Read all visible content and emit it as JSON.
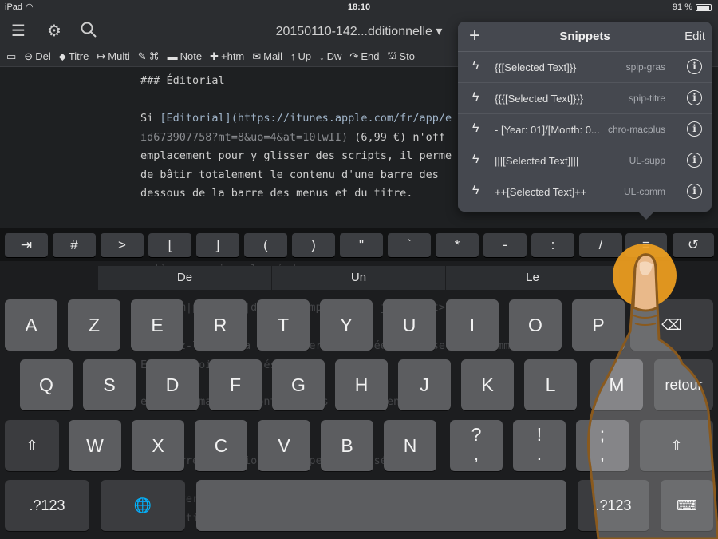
{
  "status": {
    "device": "iPad",
    "time": "18:10",
    "battery": "91 %",
    "battery_level": 0.91
  },
  "titlebar": {
    "doc_title": "20150110-142...dditionnelle ▾",
    "icons": [
      "menu-icon",
      "gear-icon",
      "search-icon"
    ]
  },
  "toolbar": {
    "items": [
      {
        "icon": "book-icon",
        "glyph": "▭",
        "label": ""
      },
      {
        "icon": "delete-circle-icon",
        "glyph": "⊖",
        "label": "Del"
      },
      {
        "icon": "tag-icon",
        "glyph": "⬥",
        "label": "Titre"
      },
      {
        "icon": "export-icon",
        "glyph": "↦",
        "label": "Multi"
      },
      {
        "icon": "edit-icon",
        "glyph": "✎",
        "label": "⌘"
      },
      {
        "icon": "comment-icon",
        "glyph": "▬",
        "label": "Note"
      },
      {
        "icon": "pin-icon",
        "glyph": "✚",
        "label": "+htm"
      },
      {
        "icon": "mail-icon",
        "glyph": "✉",
        "label": "Mail"
      },
      {
        "icon": "arrow-up-icon",
        "glyph": "↑",
        "label": "Up"
      },
      {
        "icon": "arrow-down-icon",
        "glyph": "↓",
        "label": "Dw"
      },
      {
        "icon": "end-icon",
        "glyph": "↷",
        "label": "End"
      },
      {
        "icon": "stamp-icon",
        "glyph": "⛫",
        "label": "Sto"
      }
    ]
  },
  "editor": {
    "heading": "### Éditorial",
    "line1_a": "Si ",
    "line1_b": "[Editorial](https://itunes.apple.com/fr/app/e",
    "line2_a": "id673907758?mt=8&uo=4&at=10lwII)",
    "line2_b": " (6,99 €) n'off",
    "line3": "emplacement pour y glisser des scripts, il perme",
    "line4": "de bâtir totalement le contenu d'une barre des",
    "line5": "dessous de la barre des menus et du titre."
  },
  "ghost_text": [
    "qu'à un appui prolongé deva",
    "<medium|pull.jpg|dafts <cymp...|ppl> jpg|right>",
    "Ajoutez-les de la barre, personnalisée, utiliser des commandes",
    "En tout point ajoutés",
    "et votre machine sont écrites directement",
    "Les barres additionnelles personnalisées",
    "À l'inverse, c'est vous qui êtes « maître du jeu » et de la",
    "disposition des éléments."
  ],
  "snippets": {
    "title": "Snippets",
    "add_label": "+",
    "edit_label": "Edit",
    "items": [
      {
        "text": "{{[Selected Text]}}",
        "tag": "spip-gras"
      },
      {
        "text": "{{{[Selected Text]}}}",
        "tag": "spip-titre"
      },
      {
        "text": "- [Year: 01]/[Month: 0...",
        "tag": "chro-macplus"
      },
      {
        "text": "|||[Selected Text]|||",
        "tag": "UL-supp"
      },
      {
        "text": "++[Selected Text]++",
        "tag": "UL-comm"
      }
    ]
  },
  "extra_keys": [
    "⇥",
    "#",
    ">",
    "[",
    "]",
    "(",
    ")",
    "\"",
    "`",
    "*",
    "-",
    ":",
    "/",
    "≡",
    "↺"
  ],
  "suggestions": [
    "De",
    "Un",
    "Le"
  ],
  "keys": {
    "row1": [
      "A",
      "Z",
      "E",
      "R",
      "T",
      "Y",
      "U",
      "I",
      "O",
      "P"
    ],
    "row2": [
      "Q",
      "S",
      "D",
      "F",
      "G",
      "H",
      "J",
      "K",
      "L",
      "M"
    ],
    "row3": [
      "W",
      "X",
      "C",
      "V",
      "B",
      "N"
    ],
    "punct1": "?\n,",
    "punct2": "!\n.",
    "punct3": ";\n,",
    "return_label": "retour",
    "numbers_left": ".?123",
    "numbers_right": ".?123",
    "backspace": "⌫",
    "shift": "⇧",
    "globe": "🌐",
    "hide_keyboard": "⌨"
  }
}
